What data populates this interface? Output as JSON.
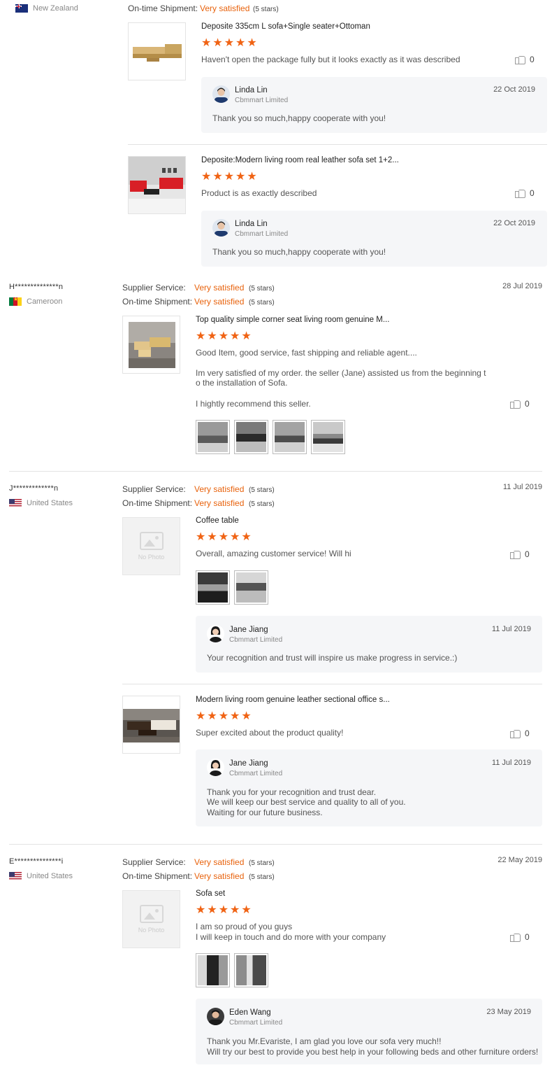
{
  "labels": {
    "supplier_service": "Supplier Service:",
    "ontime_shipment": "On-time Shipment:",
    "very_satisfied": "Very satisfied",
    "five_stars": "(5 stars)",
    "no_photo": "No Photo",
    "company": "Cbmmart Limited"
  },
  "review1": {
    "country": "New Zealand",
    "items": [
      {
        "title": "Deposite 335cm L sofa+Single seater+Ottoman",
        "text": "Haven't open the package fully but it looks exactly as it was described",
        "likes": "0",
        "rating": 5,
        "reply": {
          "name": "Linda Lin",
          "date": "22 Oct 2019",
          "text": "Thank you so much,happy cooperate with you!"
        }
      },
      {
        "title": "Deposite:Modern living room real leather sofa set 1+2...",
        "text": "Product is as exactly described",
        "likes": "0",
        "rating": 5,
        "reply": {
          "name": "Linda Lin",
          "date": "22 Oct 2019",
          "text": "Thank you so much,happy cooperate with you!"
        }
      }
    ]
  },
  "review2": {
    "buyer": "H**************n",
    "country": "Cameroon",
    "date": "28 Jul 2019",
    "title": "Top quality simple corner seat living room genuine M...",
    "text1": "Good Item, good service,  fast shipping and reliable agent....",
    "text2a": "Im very satisfied of my order. the seller (Jane) assisted us from the beginning t",
    "text2b": "o the installation of Sofa.",
    "text3": "I hightly recommend this seller.",
    "likes": "0",
    "rating": 5
  },
  "review3": {
    "buyer": "J*************n",
    "country": "United States",
    "date": "11 Jul 2019",
    "items": [
      {
        "title": "Coffee table",
        "text": "Overall, amazing customer service! Will hi",
        "likes": "0",
        "rating": 5,
        "reply": {
          "name": "Jane Jiang",
          "date": "11 Jul 2019",
          "text": "Your recognition and trust will inspire us make progress in service.:)"
        }
      },
      {
        "title": "Modern living room genuine leather sectional office s...",
        "text": "Super excited about the product quality!",
        "likes": "0",
        "rating": 5,
        "reply": {
          "name": "Jane Jiang",
          "date": "11 Jul 2019",
          "line1": "Thank you for your recognition and trust dear.",
          "line2": "We will keep our best service and quality to all of you.",
          "line3": "Waiting for our future business."
        }
      }
    ]
  },
  "review4": {
    "buyer": "E***************i",
    "country": "United States",
    "date": "22 May 2019",
    "title": "Sofa set",
    "text1": "I am so proud of you guys",
    "text2": "I will keep in touch and do more with your company",
    "likes": "0",
    "rating": 5,
    "reply": {
      "name": "Eden Wang",
      "date": "23 May 2019",
      "line1": "Thank you Mr.Evariste, I am glad you love our sofa very much!!",
      "line2": "Will try our best to provide you best help in your following beds and other furniture orders!"
    }
  },
  "colors": {
    "accent": "#e8620c",
    "star": "#f06314"
  }
}
